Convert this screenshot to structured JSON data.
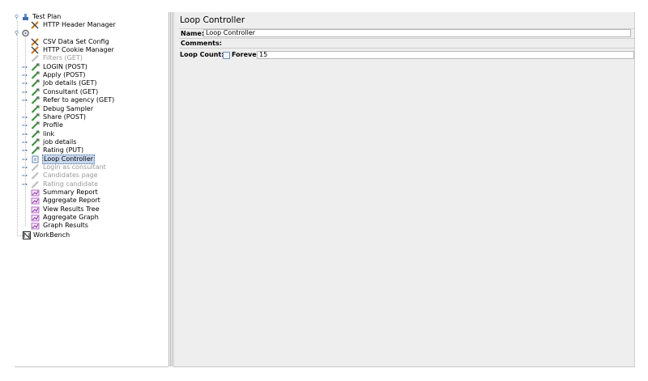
{
  "tree": {
    "root_label": "Test Plan",
    "workbench_label": "WorkBench",
    "items": [
      {
        "label": "HTTP Header Manager",
        "icon": "wrench-icon",
        "disabled": false,
        "expandable": false
      },
      {
        "label": "",
        "icon": "thread-group-icon",
        "disabled": false,
        "expandable": true
      },
      {
        "label": "CSV Data Set Config",
        "icon": "wrench-icon",
        "disabled": false,
        "expandable": false
      },
      {
        "label": "HTTP Cookie Manager",
        "icon": "wrench-icon",
        "disabled": false,
        "expandable": false
      },
      {
        "label": "Filters (GET)",
        "icon": "sampler-icon",
        "disabled": true,
        "expandable": false
      },
      {
        "label": "LOGIN (POST)",
        "icon": "sampler-icon",
        "disabled": false,
        "expandable": true
      },
      {
        "label": "Apply (POST)",
        "icon": "sampler-icon",
        "disabled": false,
        "expandable": true
      },
      {
        "label": "Job details (GET)",
        "icon": "sampler-icon",
        "disabled": false,
        "expandable": true
      },
      {
        "label": "Consultant (GET)",
        "icon": "sampler-icon",
        "disabled": false,
        "expandable": true
      },
      {
        "label": "Refer to agency (GET)",
        "icon": "sampler-icon",
        "disabled": false,
        "expandable": true
      },
      {
        "label": "Debug Sampler",
        "icon": "sampler-icon",
        "disabled": false,
        "expandable": false
      },
      {
        "label": "Share (POST)",
        "icon": "sampler-icon",
        "disabled": false,
        "expandable": true
      },
      {
        "label": "Profile",
        "icon": "sampler-icon",
        "disabled": false,
        "expandable": true
      },
      {
        "label": "link",
        "icon": "sampler-icon",
        "disabled": false,
        "expandable": true
      },
      {
        "label": "job details",
        "icon": "sampler-icon",
        "disabled": false,
        "expandable": true
      },
      {
        "label": "Rating (PUT)",
        "icon": "sampler-icon",
        "disabled": false,
        "expandable": true
      },
      {
        "label": "Loop Controller",
        "icon": "loop-controller-icon",
        "disabled": false,
        "expandable": true,
        "selected": true
      },
      {
        "label": "Login as consultant",
        "icon": "sampler-icon",
        "disabled": true,
        "expandable": true
      },
      {
        "label": "Candidates page",
        "icon": "sampler-icon",
        "disabled": true,
        "expandable": true
      },
      {
        "label": "Rating candidate",
        "icon": "sampler-icon",
        "disabled": true,
        "expandable": true
      },
      {
        "label": "Summary Report",
        "icon": "listener-icon",
        "disabled": false,
        "expandable": false
      },
      {
        "label": "Aggregate Report",
        "icon": "listener-icon",
        "disabled": false,
        "expandable": false
      },
      {
        "label": "View Results Tree",
        "icon": "listener-icon",
        "disabled": false,
        "expandable": false
      },
      {
        "label": "Aggregate Graph",
        "icon": "listener-icon",
        "disabled": false,
        "expandable": false
      },
      {
        "label": "Graph Results",
        "icon": "listener-icon",
        "disabled": false,
        "expandable": false
      }
    ]
  },
  "editor": {
    "title": "Loop Controller",
    "name_label": "Name:",
    "name_value": "Loop Controller",
    "comments_label": "Comments:",
    "loop_count_label": "Loop Count:",
    "forever_label": "Forever",
    "forever_checked": false,
    "loop_count_value": "15"
  },
  "colors": {
    "selection": "#c9d8ef",
    "disabled_text": "#9a9a9a",
    "panel_bg": "#eeeeee"
  }
}
